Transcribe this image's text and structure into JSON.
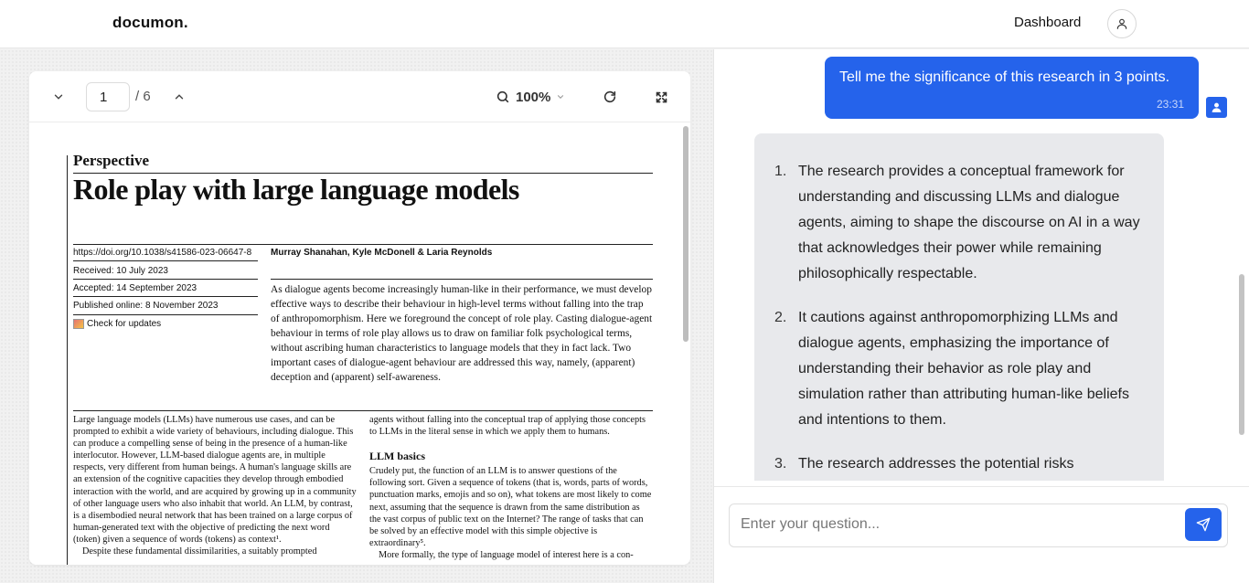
{
  "app": {
    "logo": "documon."
  },
  "nav": {
    "dashboard_label": "Dashboard"
  },
  "viewer": {
    "page_current": "1",
    "page_total": "/ 6",
    "zoom": "100%"
  },
  "paper": {
    "kicker": "Perspective",
    "title": "Role play with large language models",
    "doi": "https://doi.org/10.1038/s41586-023-06647-8",
    "authors": "Murray Shanahan, Kyle McDonell & Laria Reynolds",
    "received": "Received: 10 July 2023",
    "accepted": "Accepted: 14 September 2023",
    "published": "Published online: 8 November 2023",
    "check_updates": "Check for updates",
    "abstract": "As dialogue agents become increasingly human-like in their performance, we must develop effective ways to describe their behaviour in high-level terms without falling into the trap of anthropomorphism. Here we foreground the concept of role play. Casting dialogue-agent behaviour in terms of role play allows us to draw on familiar folk psychological terms, without ascribing human characteristics to language models that they in fact lack. Two important cases of dialogue-agent behaviour are addressed this way, namely, (apparent) deception and (apparent) self-awareness.",
    "col1": "Large language models (LLMs) have numerous use cases, and can be prompted to exhibit a wide variety of behaviours, including dialogue. This can produce a compelling sense of being in the presence of a human-like interlocutor. However, LLM-based dialogue agents are, in multiple respects, very different from human beings. A human's language skills are an extension of the cognitive capacities they develop through embodied interaction with the world, and are acquired by growing up in a community of other language users who also inhabit that world. An LLM, by contrast, is a disembodied neural network that has been trained on a large corpus of human-generated text with the objective of predicting the next word (token) given a sequence of words (tokens) as context¹.",
    "col1_tail": "Despite these fundamental dissimilarities, a suitably prompted",
    "col2_top": "agents without falling into the conceptual trap of applying those concepts to LLMs in the literal sense in which we apply them to humans.",
    "col2_heading": "LLM basics",
    "col2_body": "Crudely put, the function of an LLM is to answer questions of the following sort. Given a sequence of tokens (that is, words, parts of words, punctuation marks, emojis and so on), what tokens are most likely to come next, assuming that the sequence is drawn from the same distribution as the vast corpus of public text on the Internet? The range of tasks that can be solved by an effective model with this simple objective is extraordinary⁵.",
    "col2_tail": "More formally, the type of language model of interest here is a con-"
  },
  "chat": {
    "user_message": "Tell me the significance of this research in 3 points.",
    "user_time": "23:31",
    "ai_items": [
      {
        "num": "1.",
        "text": "The research provides a conceptual framework for understanding and discussing LLMs and dialogue agents, aiming to shape the discourse on AI in a way that acknowledges their power while remaining philosophically respectable."
      },
      {
        "num": "2.",
        "text": "It cautions against anthropomorphizing LLMs and dialogue agents, emphasizing the importance of understanding their behavior as role play and simulation rather than attributing human-like beliefs and intentions to them."
      },
      {
        "num": "3.",
        "text": "The research addresses the potential risks"
      }
    ],
    "input_placeholder": "Enter your question..."
  },
  "colors": {
    "accent": "#2563eb",
    "ai_bubble": "#e8e9ec"
  }
}
